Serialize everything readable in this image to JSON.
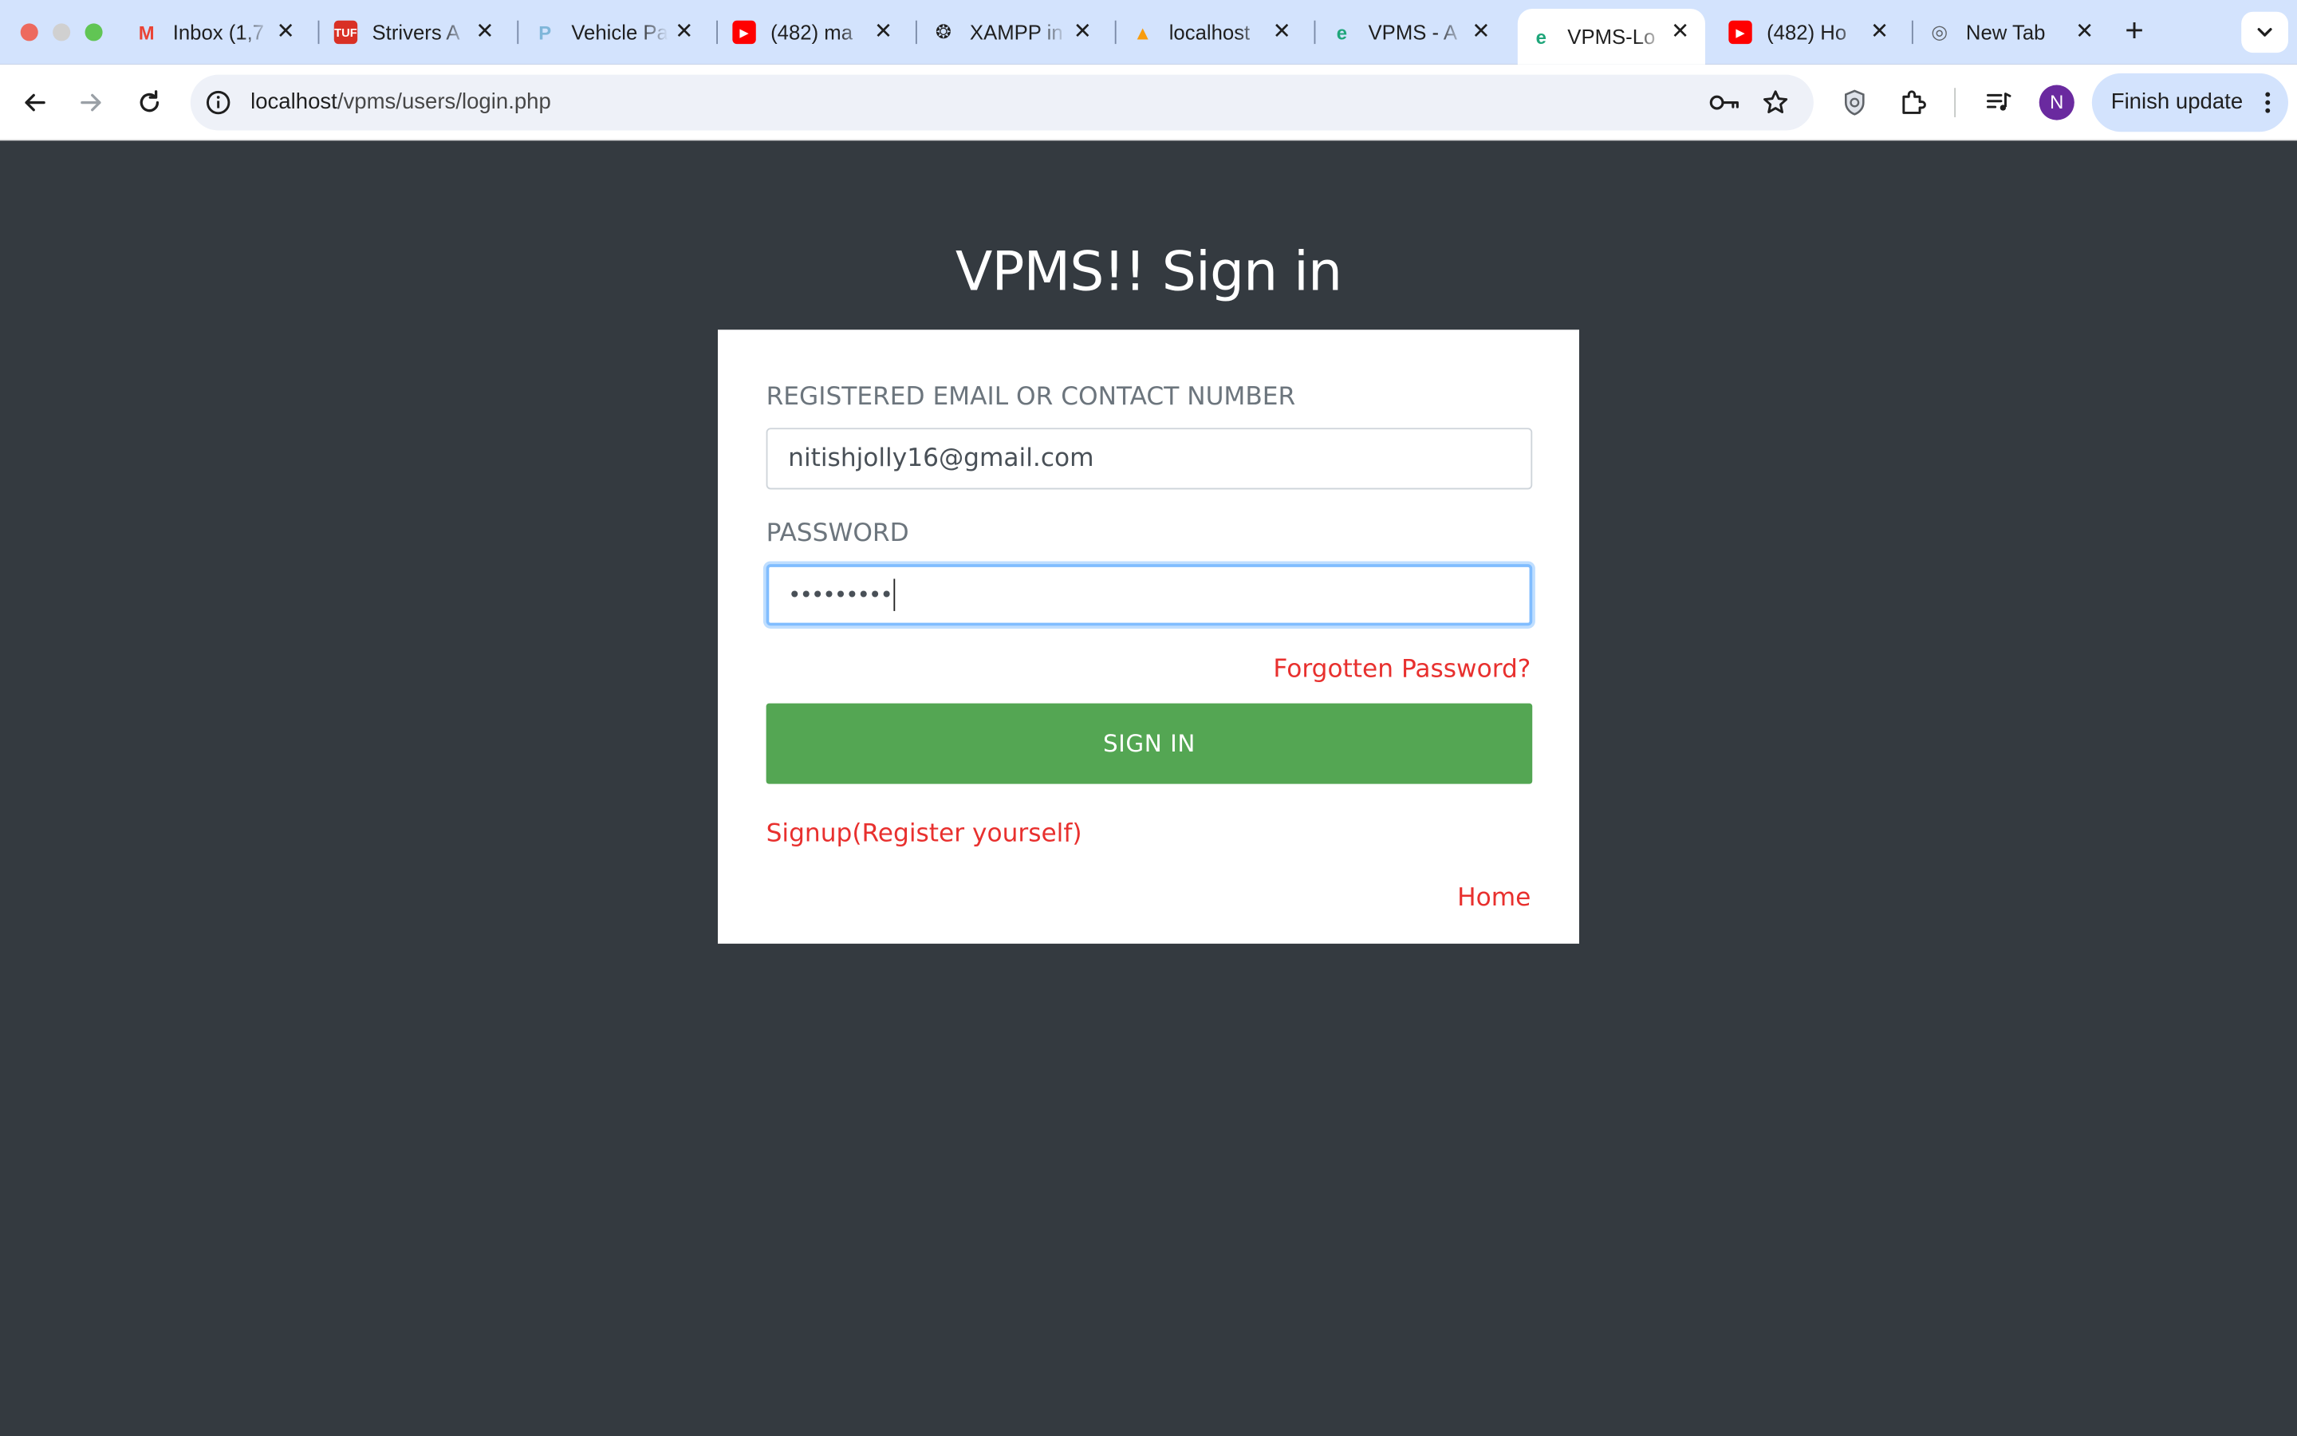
{
  "browser": {
    "tabs": [
      {
        "title": "Inbox (1,7",
        "icon": "gmail-icon",
        "color": "#ea4335",
        "active": false
      },
      {
        "title": "Strivers A",
        "icon": "tuf-icon",
        "color": "#d93025",
        "active": false
      },
      {
        "title": "Vehicle Pa",
        "icon": "vehicle-parking-icon",
        "color": "#7fb6d9",
        "active": false
      },
      {
        "title": "(482) ma",
        "icon": "youtube-icon",
        "color": "#ff0000",
        "active": false
      },
      {
        "title": "XAMPP in",
        "icon": "openai-icon",
        "color": "#1f1f1f",
        "active": false
      },
      {
        "title": "localhost",
        "icon": "phpmyadmin-icon",
        "color": "#f89c0e",
        "active": false
      },
      {
        "title": "VPMS - A",
        "icon": "vpms-icon",
        "color": "#1fa67a",
        "active": false
      },
      {
        "title": "VPMS-Lo",
        "icon": "vpms-icon",
        "color": "#1fa67a",
        "active": true
      },
      {
        "title": "(482) Ho",
        "icon": "youtube-icon",
        "color": "#ff0000",
        "active": false
      },
      {
        "title": "New Tab",
        "icon": "chrome-icon",
        "color": "#5f6368",
        "active": false
      }
    ],
    "url_host": "localhost",
    "url_path": "/vpms/users/login.php",
    "profile_initial": "N",
    "finish_update_label": "Finish update"
  },
  "login": {
    "heading": "VPMS!! Sign in",
    "email_label": "REGISTERED EMAIL OR CONTACT NUMBER",
    "email_value": "nitishjolly16@gmail.com",
    "password_label": "PASSWORD",
    "password_masked": "•••••••••",
    "forgot_label": "Forgotten Password?",
    "signin_label": "SIGN IN",
    "signup_label": "Signup(Register yourself)",
    "home_label": "Home"
  },
  "colors": {
    "page_bg": "#343a40",
    "button_green": "#54a653",
    "link_red": "#e8302e",
    "focus_blue": "#80bdff"
  }
}
